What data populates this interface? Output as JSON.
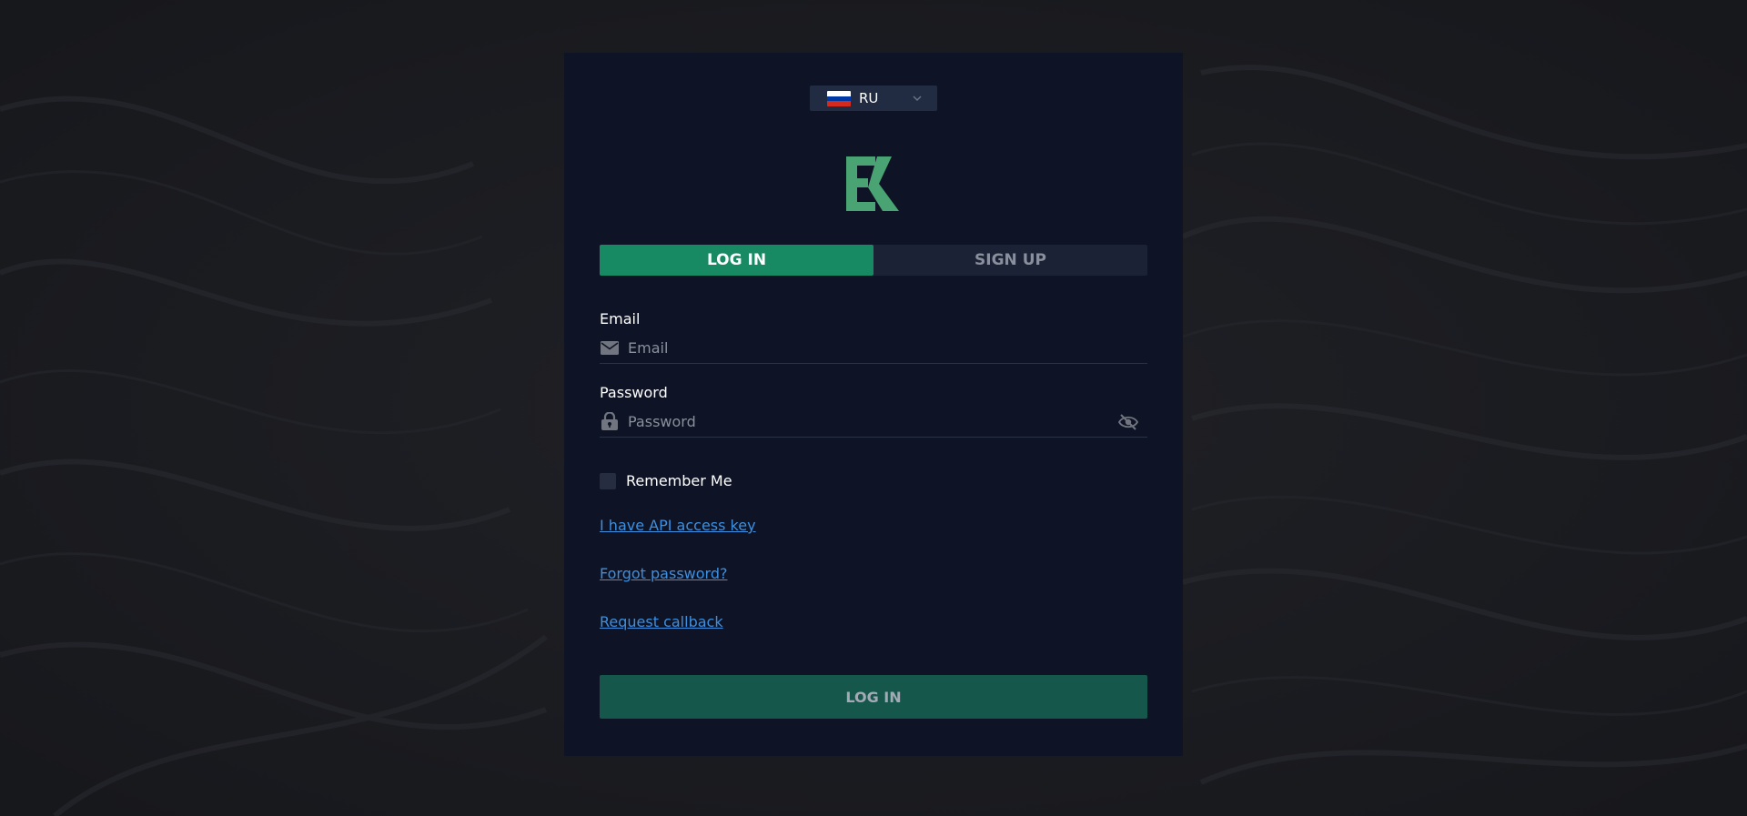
{
  "language": {
    "code": "RU",
    "flag_colors": [
      "#ffffff",
      "#0039a6",
      "#d52b1e"
    ]
  },
  "logo": {
    "icon": "ek-logo-icon",
    "color": "#4aa373"
  },
  "tabs": [
    {
      "label": "LOG IN",
      "active": true
    },
    {
      "label": "SIGN UP",
      "active": false
    }
  ],
  "form": {
    "email": {
      "label": "Email",
      "placeholder": "Email",
      "value": "",
      "icon": "envelope-icon"
    },
    "password": {
      "label": "Password",
      "placeholder": "Password",
      "value": "",
      "icon": "lock-icon",
      "toggle_icon": "eye-slash-icon"
    },
    "remember_label": "Remember Me",
    "remember_checked": false
  },
  "links": {
    "api_key": "I have API access key",
    "forgot": "Forgot password?",
    "callback": "Request callback"
  },
  "submit_label": "LOG IN",
  "colors": {
    "accent": "#178a64",
    "submit_bg": "#15574a",
    "card_bg": "#0e1425",
    "link": "#3d8fe0"
  }
}
